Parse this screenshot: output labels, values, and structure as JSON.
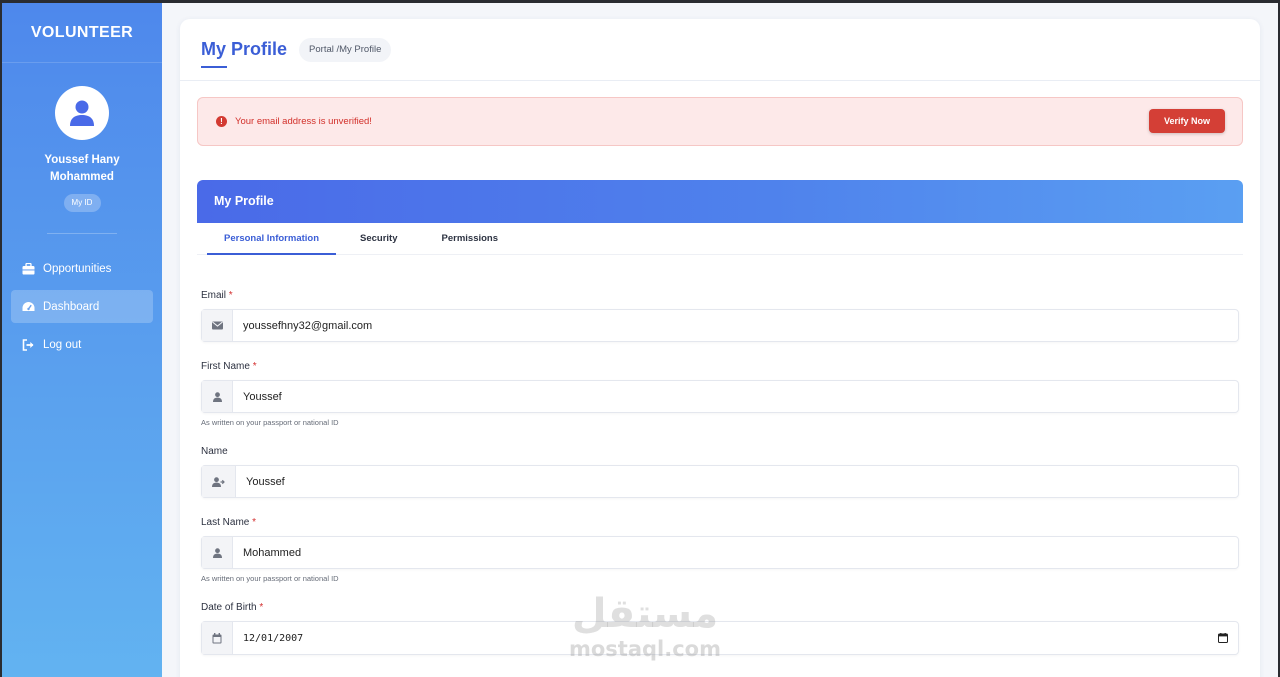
{
  "sidebar": {
    "brand": "VOLUNTEER",
    "user_name": "Youssef Hany Mohammed",
    "id_badge": "My ID",
    "items": [
      {
        "label": "Opportunities",
        "icon": "briefcase-icon",
        "active": false
      },
      {
        "label": "Dashboard",
        "icon": "dashboard-gauge-icon",
        "active": true
      },
      {
        "label": "Log out",
        "icon": "logout-icon",
        "active": false
      }
    ]
  },
  "header": {
    "title": "My Profile",
    "breadcrumb": "Portal  /My Profile"
  },
  "alert": {
    "icon": "exclamation-circle-icon",
    "message": "Your email address is unverified!",
    "button_label": "Verify Now"
  },
  "profile_card": {
    "title": "My Profile",
    "tabs": [
      "Personal Information",
      "Security",
      "Permissions"
    ],
    "active_tab": "Personal Information"
  },
  "form": {
    "email": {
      "label": "Email",
      "required": "*",
      "value": "youssefhny32@gmail.com",
      "icon": "envelope-icon"
    },
    "first_name": {
      "label": "First Name",
      "required": "*",
      "value": "Youssef",
      "icon": "user-icon",
      "help": "As written on your passport or national ID"
    },
    "name": {
      "label": "Name",
      "value": "Youssef",
      "icon": "user-arrow-icon"
    },
    "last_name": {
      "label": "Last Name",
      "required": "*",
      "value": "Mohammed",
      "icon": "user-icon",
      "help": "As written on your passport or national ID"
    },
    "dob": {
      "label": "Date of Birth",
      "required": "*",
      "value": "12/01/2007",
      "icon": "calendar-icon"
    }
  },
  "watermark": {
    "arabic": "مستقل",
    "latin": "mostaql.com"
  },
  "colors": {
    "accent": "#3b5ed6",
    "sidebar_top": "#4e88ec",
    "sidebar_bottom": "#62b3f1",
    "alert_bg": "#fde9e9",
    "alert_text": "#d2302a",
    "verify_button": "#d43f36"
  }
}
